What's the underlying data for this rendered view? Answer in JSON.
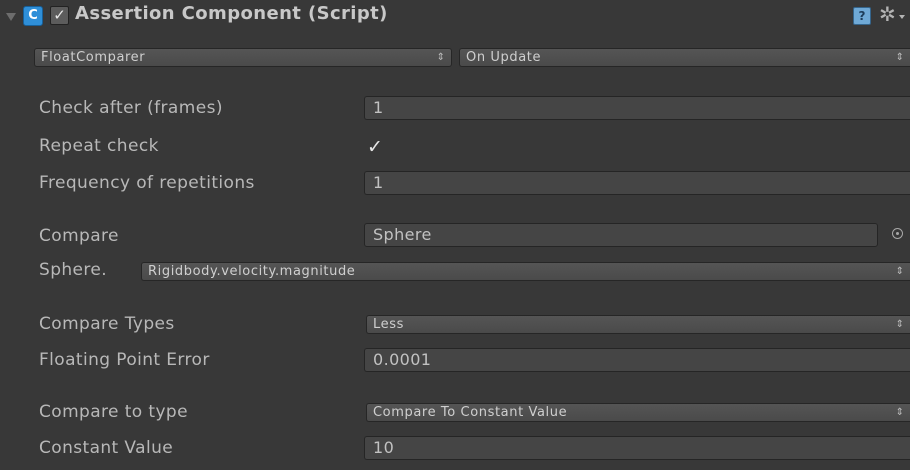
{
  "header": {
    "title": "Assertion Component (Script)",
    "script_icon": "script-icon",
    "enabled_check": "✓",
    "help_icon": "help-icon",
    "help_glyph": "?",
    "settings_icon": "gear-icon",
    "settings_glyph": "✲"
  },
  "selectors": {
    "comparer": "FloatComparer",
    "check_method": "On Update",
    "popup_arrows": "⇕"
  },
  "fields": {
    "check_after_label": "Check after (frames)",
    "check_after_value": "1",
    "repeat_check_label": "Repeat check",
    "repeat_check_value": "✓",
    "frequency_label": "Frequency of repetitions",
    "frequency_value": "1",
    "compare_label": "Compare",
    "compare_value": "Sphere",
    "compare_picker_icon": "object-picker-icon",
    "path_prefix": "Sphere.",
    "path_value": "Rigidbody.velocity.magnitude",
    "compare_types_label": "Compare Types",
    "compare_types_value": "Less",
    "fp_error_label": "Floating Point Error",
    "fp_error_value": "0.0001",
    "compare_to_type_label": "Compare to type",
    "compare_to_type_value": "Compare To Constant Value",
    "constant_value_label": "Constant Value",
    "constant_value_value": "10"
  }
}
